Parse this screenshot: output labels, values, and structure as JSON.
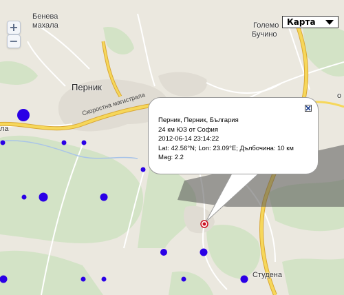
{
  "map": {
    "zoom_in_label": "+",
    "zoom_out_label": "−",
    "map_type_label": "Карта"
  },
  "places": {
    "beneva_1": "Бенева",
    "beneva_2": "махала",
    "golemo_1": "Големо",
    "golemo_2": "Бучино",
    "pernik": "Перник",
    "road": "Скоростна магистрала",
    "studena": "Студена",
    "la": "ла",
    "o": "о"
  },
  "popup": {
    "line1": "Перник, Перник, България",
    "line2": "24 км ЮЗ от София",
    "line3": "2012-06-14 23:14:22",
    "line4": "Lat: 42.56°N; Lon: 23.09°E; Дълбочина: 10 км",
    "line5": "Mag: 2.2"
  },
  "colors": {
    "quake_marker": "#2a00e6",
    "selected_marker": "#cc1122",
    "highway": "#f2cf4a",
    "forest": "#d2e2c4"
  }
}
